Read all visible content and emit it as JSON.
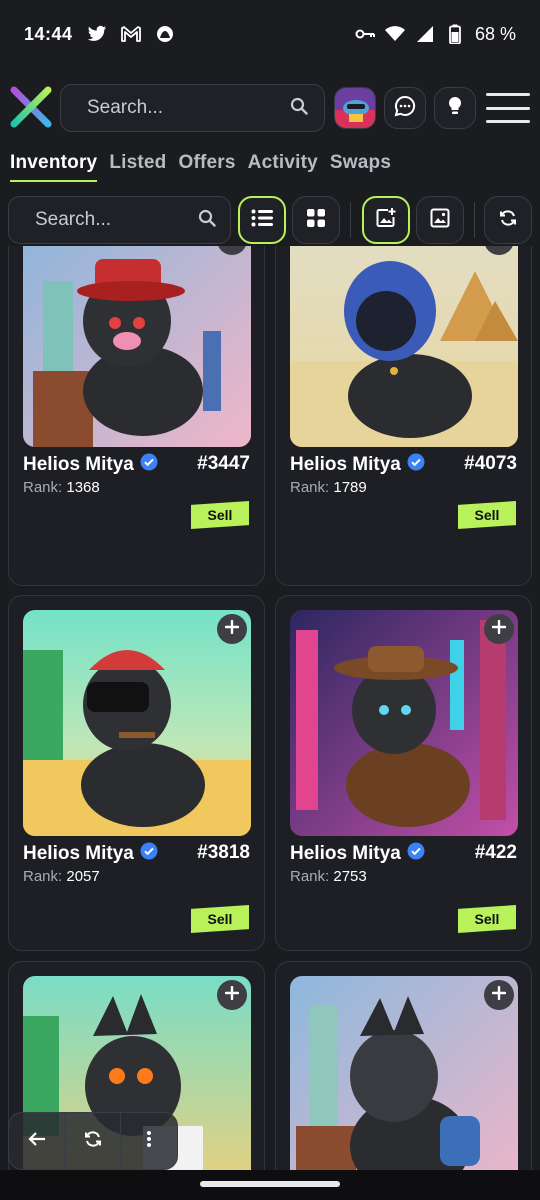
{
  "status": {
    "time": "14:44",
    "left_icons": [
      "twitter-icon",
      "gmail-icon",
      "app-notification-icon"
    ],
    "right_icons": [
      "vpn-key-icon",
      "wifi-icon",
      "signal-icon",
      "battery-icon"
    ],
    "battery": "68 %"
  },
  "header": {
    "search_placeholder": "Search...",
    "icons": [
      "logo-x-icon",
      "search-icon",
      "chat-icon",
      "lightbulb-icon",
      "hamburger-menu-icon"
    ]
  },
  "tabs": [
    {
      "label": "Inventory",
      "active": true
    },
    {
      "label": "Listed",
      "active": false
    },
    {
      "label": "Offers",
      "active": false
    },
    {
      "label": "Activity",
      "active": false
    },
    {
      "label": "Swaps",
      "active": false
    }
  ],
  "toolbar": {
    "search_placeholder": "Search...",
    "buttons": [
      "list-view-icon",
      "grid-view-icon",
      "add-image-icon",
      "image-icon",
      "refresh-icon"
    ]
  },
  "cards": [
    {
      "name": "Helios Mitya",
      "number": "#3447",
      "rank_label": "Rank:",
      "rank": "1368",
      "sell": "Sell",
      "bg": [
        "#8ab6dc",
        "#f0b6c8"
      ]
    },
    {
      "name": "Helios Mitya",
      "number": "#4073",
      "rank_label": "Rank:",
      "rank": "1789",
      "sell": "Sell",
      "bg": [
        "#d9d5b5",
        "#e7d7a4"
      ]
    },
    {
      "name": "Helios Mitya",
      "number": "#3818",
      "rank_label": "Rank:",
      "rank": "2057",
      "sell": "Sell",
      "bg": [
        "#6fe0c6",
        "#f2c766"
      ]
    },
    {
      "name": "Helios Mitya",
      "number": "#422",
      "rank_label": "Rank:",
      "rank": "2753",
      "sell": "Sell",
      "bg": [
        "#3b2a6e",
        "#c24fa8"
      ]
    },
    {
      "name": "",
      "number": "",
      "rank_label": "",
      "rank": "",
      "sell": "",
      "bg": [
        "#79ddc6",
        "#f0cf7a"
      ]
    },
    {
      "name": "",
      "number": "",
      "rank_label": "",
      "rank": "",
      "sell": "",
      "bg": [
        "#8cb8dd",
        "#f0b6c8"
      ]
    }
  ],
  "colors": {
    "accent": "#b8f15a",
    "background": "#1b1c20",
    "card": "#1d1f24",
    "verified": "#3b82f6"
  }
}
